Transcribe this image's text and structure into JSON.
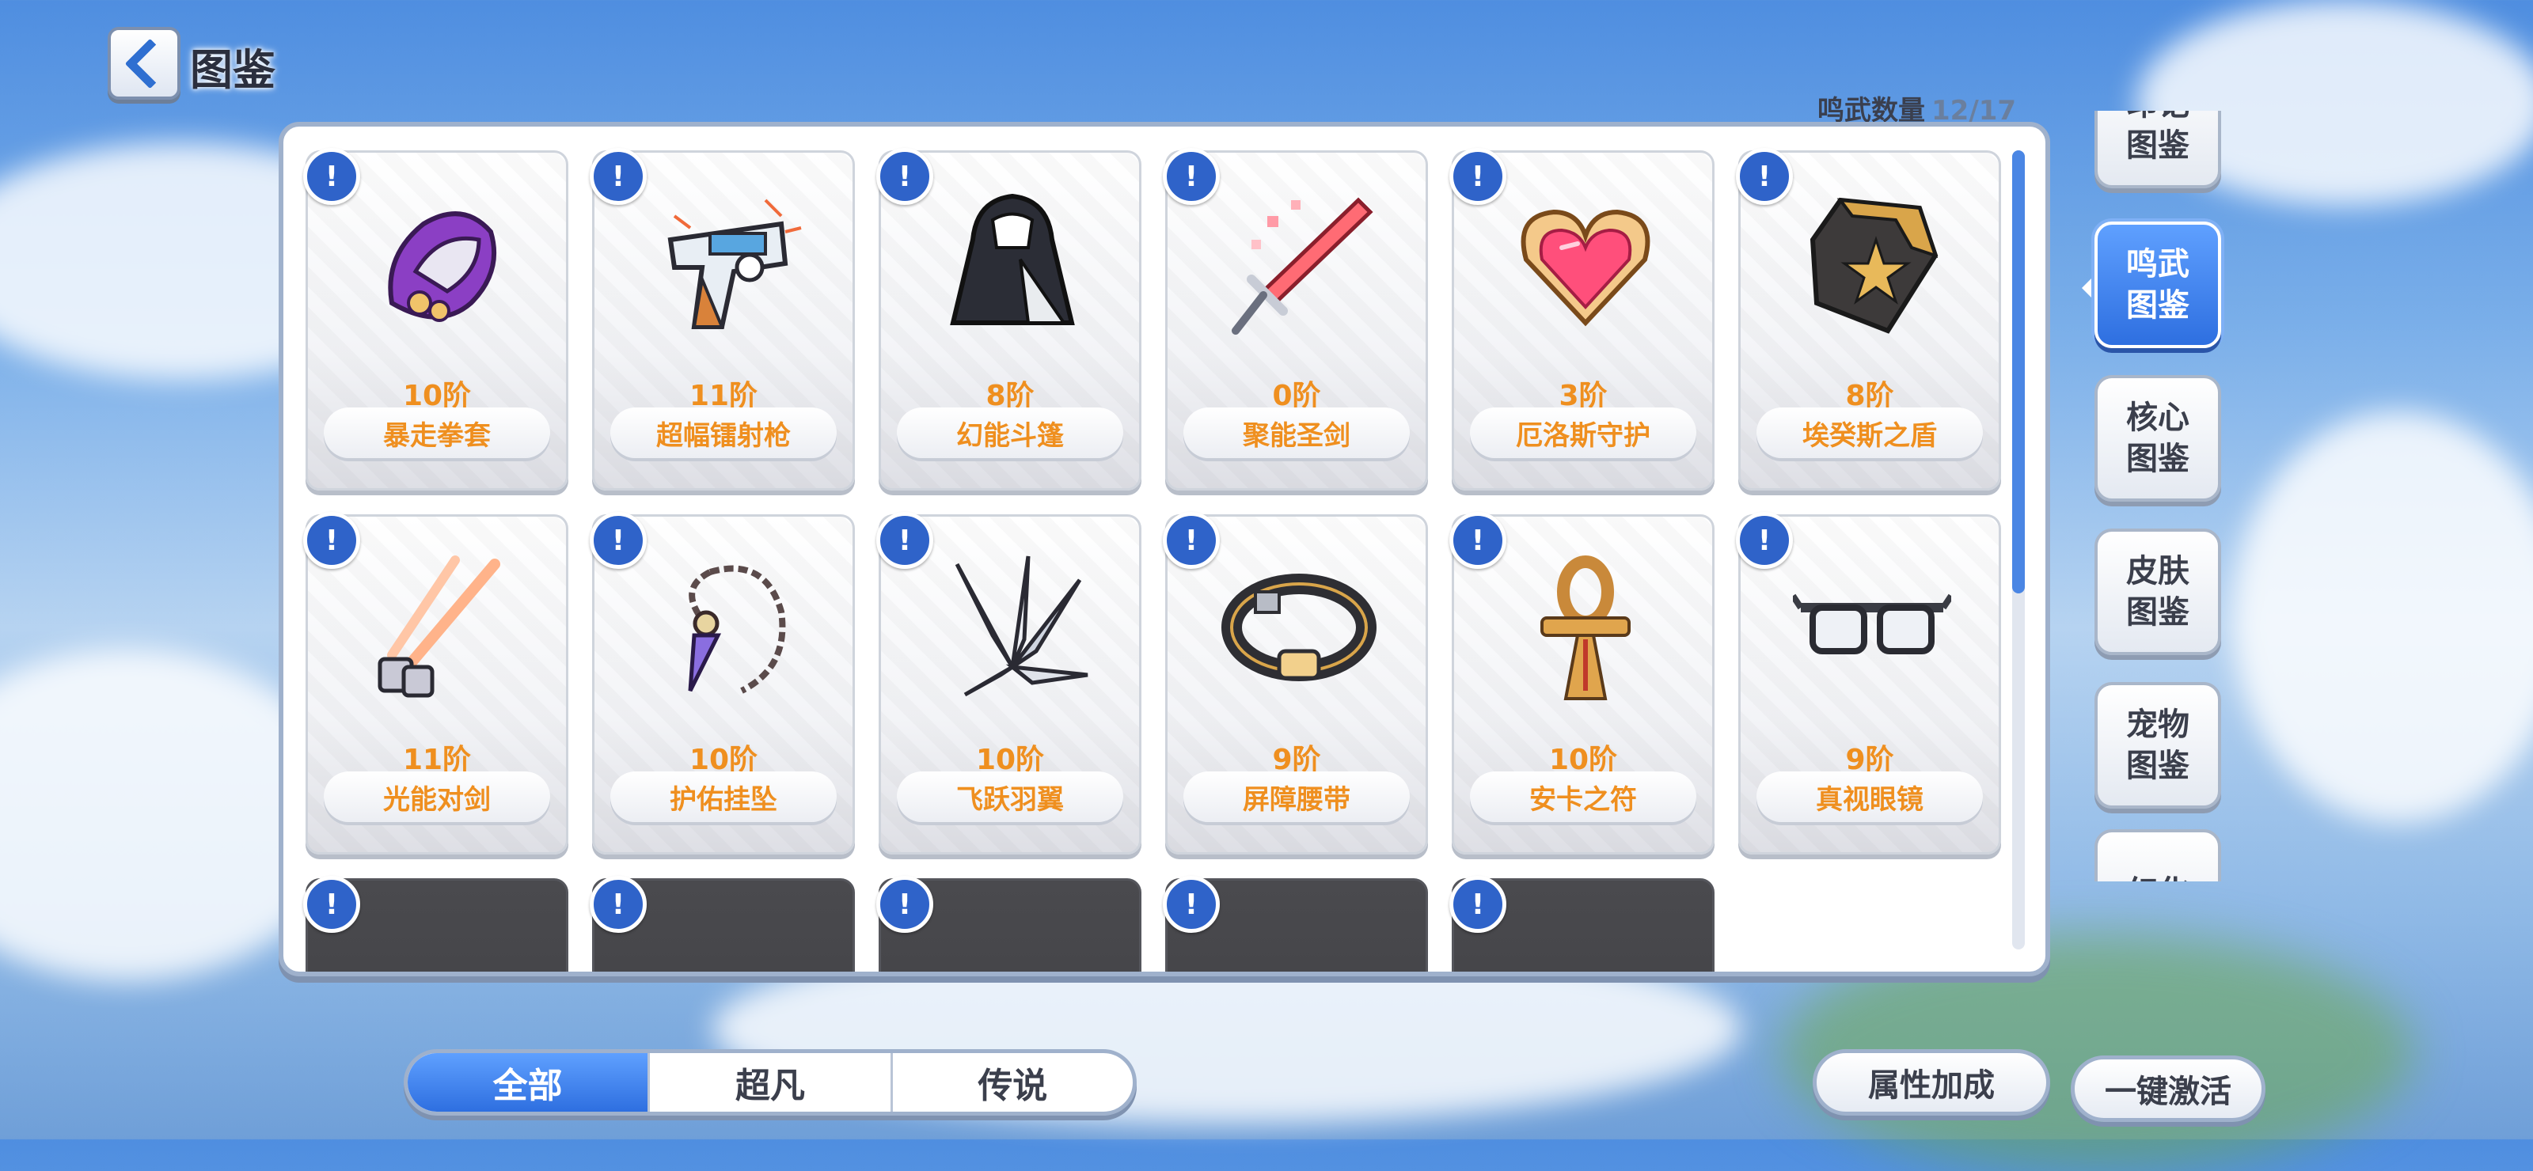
{
  "header": {
    "back_icon": "chevron-left-icon",
    "title": "图鉴"
  },
  "counter": {
    "label": "鸣武数量",
    "value": "12/17"
  },
  "badge_glyph": "!",
  "items": [
    {
      "tier": "10阶",
      "name": "暴走拳套",
      "icon": "gauntlet-icon",
      "locked": false
    },
    {
      "tier": "11阶",
      "name": "超幅镭射枪",
      "icon": "laser-gun-icon",
      "locked": false
    },
    {
      "tier": "8阶",
      "name": "幻能斗篷",
      "icon": "cloak-icon",
      "locked": false
    },
    {
      "tier": "0阶",
      "name": "聚能圣剑",
      "icon": "sword-icon",
      "locked": false
    },
    {
      "tier": "3阶",
      "name": "厄洛斯守护",
      "icon": "heart-gem-icon",
      "locked": false
    },
    {
      "tier": "8阶",
      "name": "埃癸斯之盾",
      "icon": "shield-icon",
      "locked": false
    },
    {
      "tier": "11阶",
      "name": "光能对剑",
      "icon": "twin-blades-icon",
      "locked": false
    },
    {
      "tier": "10阶",
      "name": "护佑挂坠",
      "icon": "pendant-icon",
      "locked": false
    },
    {
      "tier": "10阶",
      "name": "飞跃羽翼",
      "icon": "wing-icon",
      "locked": false
    },
    {
      "tier": "9阶",
      "name": "屏障腰带",
      "icon": "belt-icon",
      "locked": false
    },
    {
      "tier": "10阶",
      "name": "安卡之符",
      "icon": "ankh-icon",
      "locked": false
    },
    {
      "tier": "9阶",
      "name": "真视眼镜",
      "icon": "glasses-icon",
      "locked": false
    },
    {
      "locked": true
    },
    {
      "locked": true
    },
    {
      "locked": true
    },
    {
      "locked": true
    },
    {
      "locked": true
    }
  ],
  "side_tabs": [
    {
      "label": "印记图鉴",
      "active": false
    },
    {
      "label": "鸣武图鉴",
      "active": true
    },
    {
      "label": "核心图鉴",
      "active": false
    },
    {
      "label": "皮肤图鉴",
      "active": false
    },
    {
      "label": "宠物图鉴",
      "active": false
    },
    {
      "label": "幻化",
      "active": false
    }
  ],
  "filters": [
    {
      "label": "全部",
      "active": true
    },
    {
      "label": "超凡",
      "active": false
    },
    {
      "label": "传说",
      "active": false
    }
  ],
  "buttons": {
    "attribute_bonus": "属性加成",
    "activate_all": "一键激活"
  },
  "colors": {
    "accent_blue": "#2e6fe0",
    "tier_orange": "#ef8f1f",
    "badge_blue": "#2f63c9"
  }
}
